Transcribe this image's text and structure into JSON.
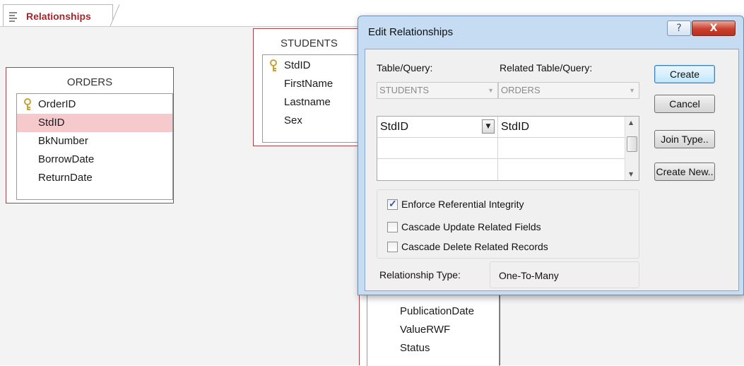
{
  "tab": {
    "label": "Relationships",
    "icon": "relationships-icon"
  },
  "tables": {
    "orders": {
      "title": "ORDERS",
      "fields": [
        "OrderID",
        "StdID",
        "BkNumber",
        "BorrowDate",
        "ReturnDate"
      ],
      "primary_key": "OrderID",
      "selected_field": "StdID"
    },
    "students": {
      "title": "STUDENTS",
      "fields": [
        "StdID",
        "FirstName",
        "Lastname",
        "Sex"
      ],
      "primary_key": "StdID"
    },
    "books": {
      "fields": [
        "PublicationDate",
        "ValueRWF",
        "Status"
      ]
    }
  },
  "dialog": {
    "title": "Edit Relationships",
    "help_label": "?",
    "close_label": "X",
    "table_query_label": "Table/Query:",
    "related_table_query_label": "Related Table/Query:",
    "table_query_value": "STUDENTS",
    "related_table_query_value": "ORDERS",
    "field_rows": [
      {
        "left": "StdID",
        "right": "StdID"
      },
      {
        "left": "",
        "right": ""
      },
      {
        "left": "",
        "right": ""
      }
    ],
    "enforce_integrity": {
      "label": "Enforce Referential Integrity",
      "checked": true
    },
    "cascade_update": {
      "label": "Cascade Update Related Fields",
      "checked": false
    },
    "cascade_delete": {
      "label": "Cascade Delete Related Records",
      "checked": false
    },
    "relationship_type_label": "Relationship Type:",
    "relationship_type_value": "One-To-Many",
    "buttons": {
      "create": "Create",
      "cancel": "Cancel",
      "join_type": "Join Type..",
      "create_new": "Create New.."
    }
  },
  "colors": {
    "accent": "#a4262c",
    "selection": "#f6c9cd",
    "dialog_frame": "#c5dcf2",
    "close_button": "#c9402d"
  }
}
